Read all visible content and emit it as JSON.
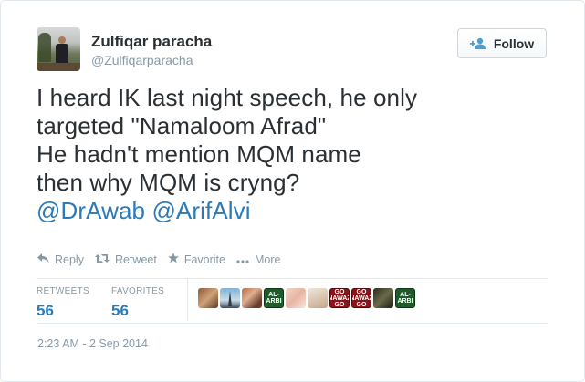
{
  "user": {
    "display_name": "Zulfiqar paracha",
    "handle": "@Zulfiqarparacha"
  },
  "follow_button": {
    "label": "Follow",
    "icon": "person-add-icon"
  },
  "tweet": {
    "lines": [
      "I heard IK last night speech, he only",
      "targeted \"Namaloom Afrad\"",
      "He hadn't mention MQM name",
      "then why MQM is cryng?"
    ],
    "mentions": [
      "@DrAwab",
      "@ArifAlvi"
    ]
  },
  "actions": [
    {
      "label": "Reply",
      "icon": "reply-icon"
    },
    {
      "label": "Retweet",
      "icon": "retweet-icon"
    },
    {
      "label": "Favorite",
      "icon": "star-icon"
    },
    {
      "label": "More",
      "icon": "more-dots-icon"
    }
  ],
  "stats": {
    "retweets_label": "RETWEETS",
    "retweets_value": "56",
    "favorites_label": "FAVORITES",
    "favorites_value": "56"
  },
  "favoriters": [
    {
      "style": "photo-brown",
      "text": ""
    },
    {
      "style": "photo-sky",
      "text": ""
    },
    {
      "style": "photo-group",
      "text": ""
    },
    {
      "style": "green-logo",
      "text": "AL-ARBI"
    },
    {
      "style": "photo-pink",
      "text": ""
    },
    {
      "style": "photo-pale",
      "text": ""
    },
    {
      "style": "red-logo",
      "text": "GO NAWAZ GO"
    },
    {
      "style": "red-logo",
      "text": "GO NAWAZ GO"
    },
    {
      "style": "photo-dark",
      "text": ""
    },
    {
      "style": "green-logo",
      "text": "AL-ARBI"
    }
  ],
  "timestamp": "2:23 AM - 2 Sep 2014",
  "colors": {
    "link": "#2b7bb9",
    "text": "#292f33",
    "muted": "#8899a6",
    "border": "#e1e8ed"
  }
}
